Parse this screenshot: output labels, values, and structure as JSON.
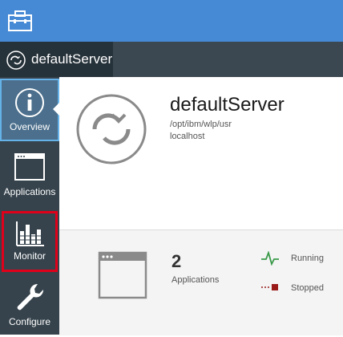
{
  "topbar": {
    "icon": "toolbox-icon"
  },
  "server_tab": {
    "icon": "server-sync-icon",
    "label": "defaultServer"
  },
  "sidebar": {
    "items": [
      {
        "key": "overview",
        "label": "Overview",
        "icon": "info-icon",
        "selected": true
      },
      {
        "key": "applications",
        "label": "Applications",
        "icon": "app-window-icon"
      },
      {
        "key": "monitor",
        "label": "Monitor",
        "icon": "bar-chart-icon",
        "highlighted": true
      },
      {
        "key": "configure",
        "label": "Configure",
        "icon": "wrench-icon"
      }
    ]
  },
  "server": {
    "name": "defaultServer",
    "path": "/opt/ibm/wlp/usr",
    "host": "localhost"
  },
  "stats": {
    "app_count": "2",
    "app_label": "Applications",
    "running_label": "Running",
    "stopped_label": "Stopped"
  },
  "colors": {
    "topbar": "#4689d4",
    "sidebar": "#36434c",
    "selected_border": "#64b2e8",
    "highlight": "#e0001a",
    "running": "#3a9a4a",
    "stopped": "#9a1a1a"
  }
}
